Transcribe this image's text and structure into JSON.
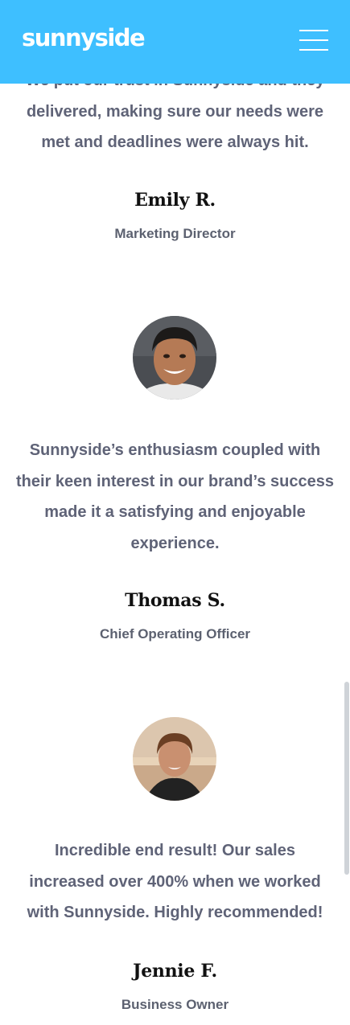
{
  "header": {
    "logo": "sunnyside",
    "menu_icon": "hamburger-menu-icon",
    "background_color": "#3ebfff"
  },
  "testimonials": [
    {
      "quote": "We put our trust in Sunnyside and they delivered, making sure our needs were met and deadlines were always hit.",
      "name": "Emily R.",
      "role": "Marketing Director"
    },
    {
      "quote": "Sunnyside’s enthusiasm coupled with their keen interest in our brand’s success made it a satisfying and enjoyable experience.",
      "name": "Thomas S.",
      "role": "Chief Operating Officer"
    },
    {
      "quote": "Incredible end result! Our sales increased over 400% when we worked with Sunnyside. Highly recommended!",
      "name": "Jennie F.",
      "role": "Business Owner"
    }
  ]
}
